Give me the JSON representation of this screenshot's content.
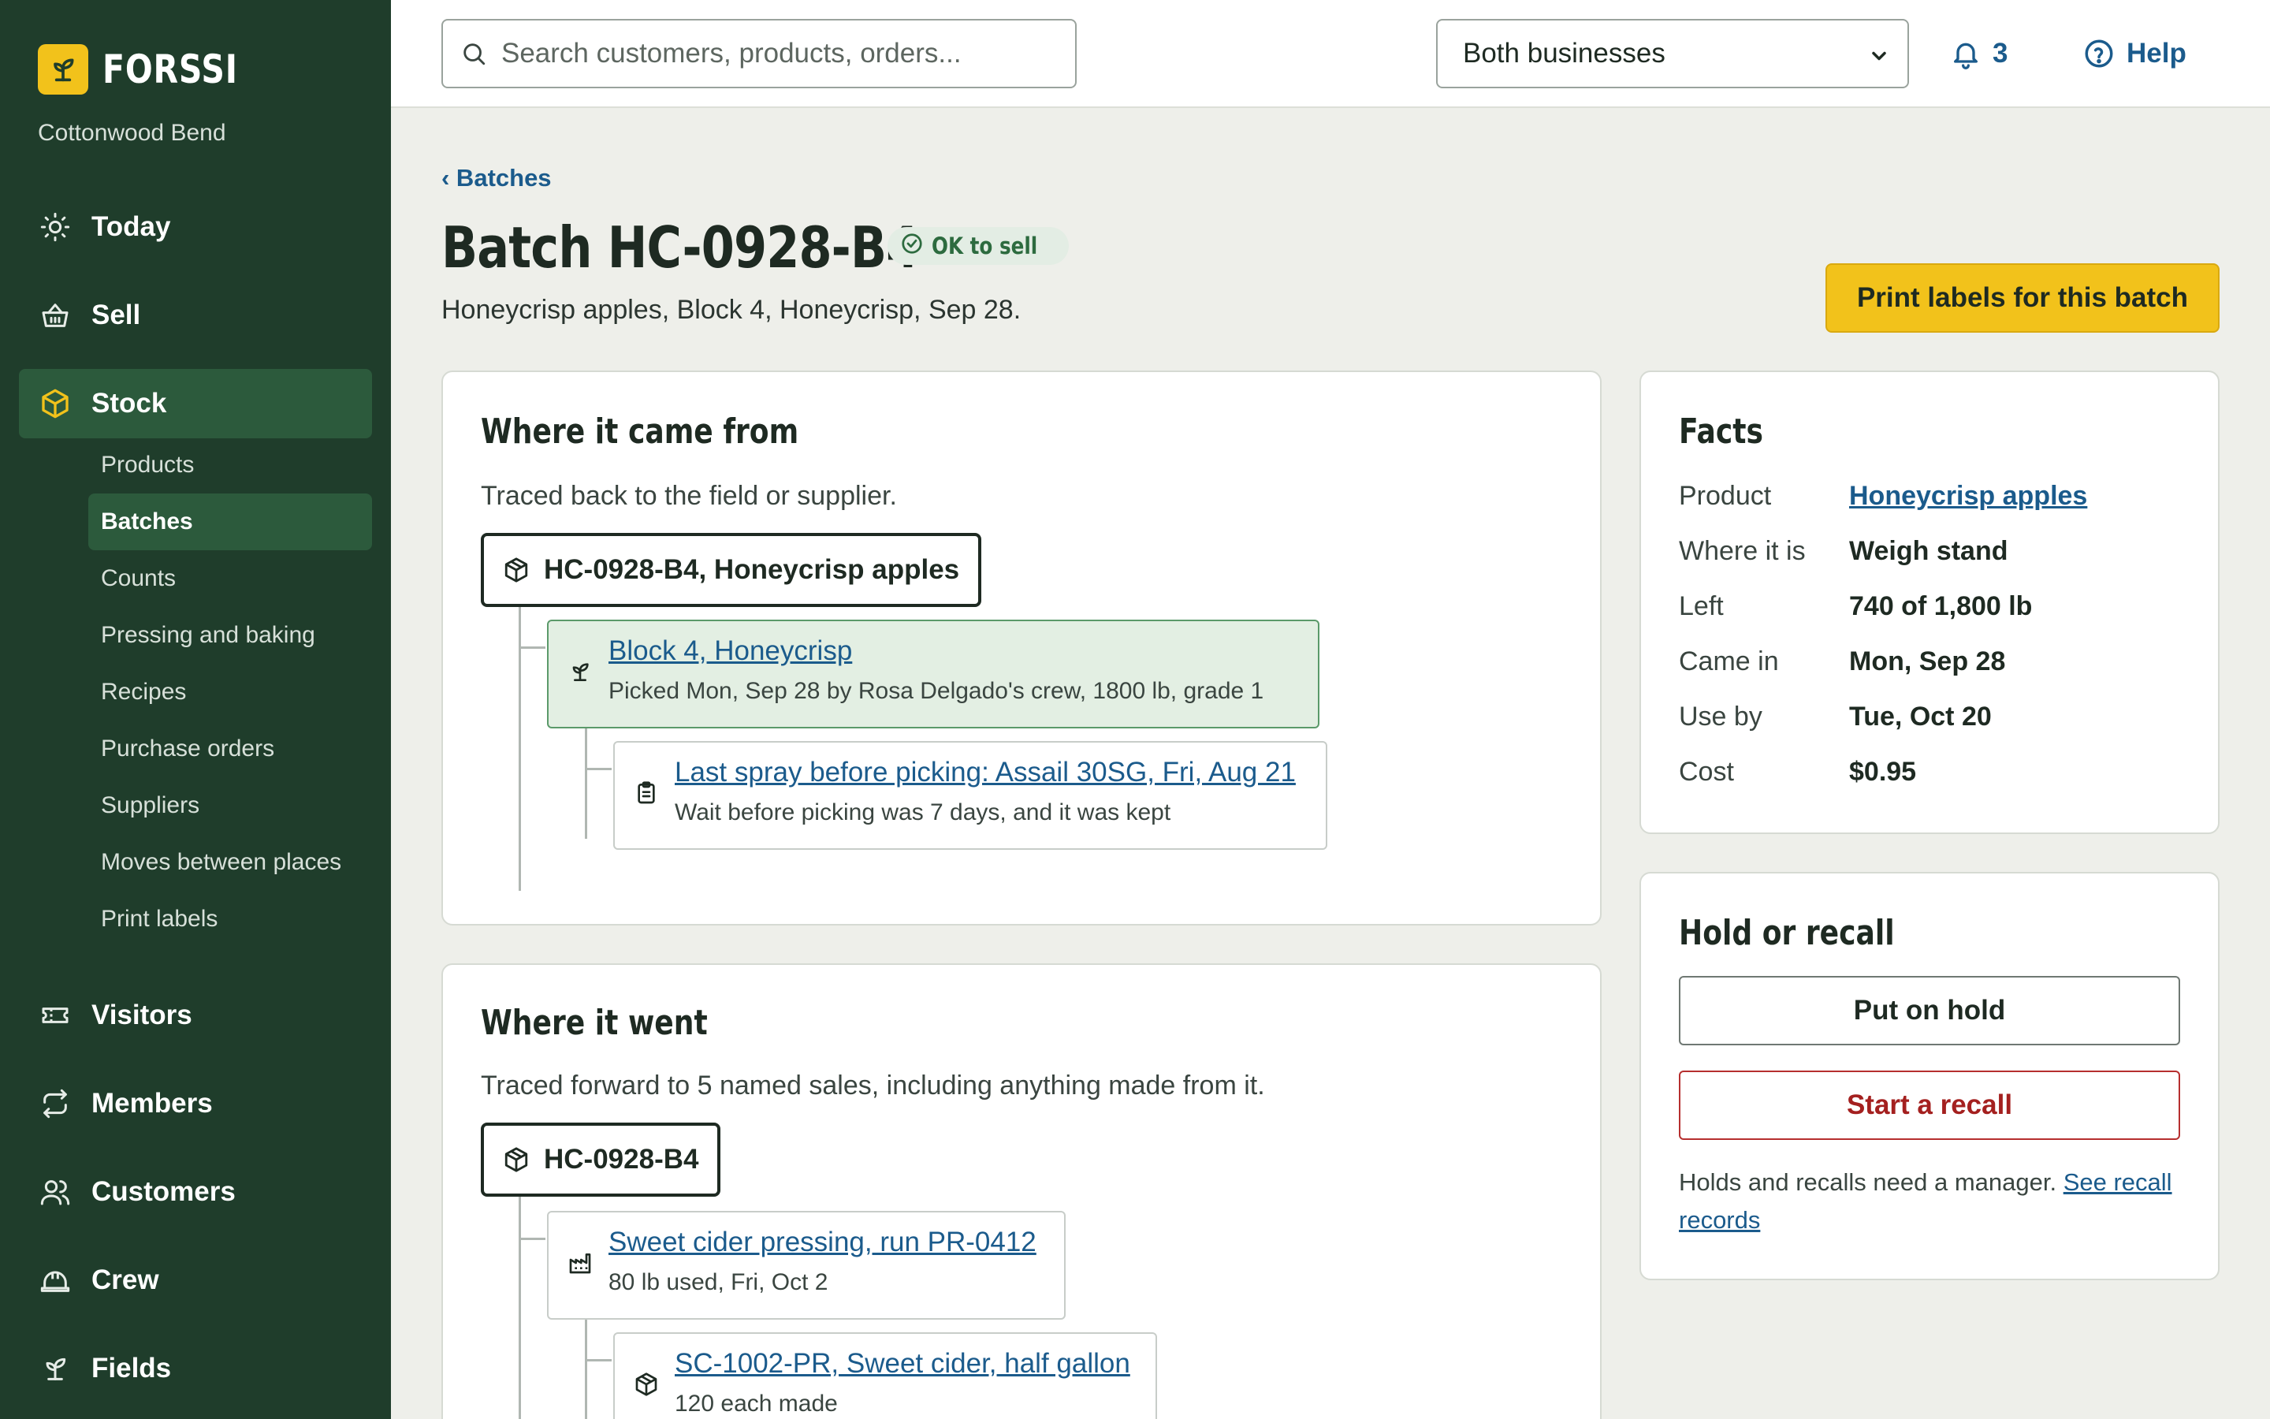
{
  "brand": {
    "name": "FORSSI",
    "org": "Cottonwood Bend",
    "accent": "#f2c21b",
    "sidebar_bg": "#1f3d2b"
  },
  "nav": {
    "today": "Today",
    "sell": "Sell",
    "stock": "Stock",
    "stock_sub": [
      "Products",
      "Batches",
      "Counts",
      "Pressing and baking",
      "Recipes",
      "Purchase orders",
      "Suppliers",
      "Moves between places",
      "Print labels"
    ],
    "visitors": "Visitors",
    "members": "Members",
    "customers": "Customers",
    "crew": "Crew",
    "fields": "Fields"
  },
  "topbar": {
    "search_placeholder": "Search customers, products, orders...",
    "business_selected": "Both businesses",
    "notifications": "3",
    "help": "Help"
  },
  "page": {
    "breadcrumb": "‹ Batches",
    "title": "Batch HC-0928-B4",
    "status": "OK to sell",
    "subtitle": "Honeycrisp apples, Block 4, Honeycrisp, Sep 28.",
    "print_button": "Print labels for this batch"
  },
  "came_from": {
    "title": "Where it came from",
    "desc": "Traced back to the field or supplier.",
    "root": "HC-0928-B4, Honeycrisp apples",
    "nodes": [
      {
        "link": "Block 4, Honeycrisp",
        "meta": "Picked Mon, Sep 28 by Rosa Delgado's crew, 1800 lb, grade 1",
        "icon": "sprout-icon"
      },
      {
        "link": "Last spray before picking: Assail 30SG, Fri, Aug 21",
        "meta": "Wait before picking was 7 days, and it was kept",
        "icon": "clipboard-icon"
      }
    ]
  },
  "went": {
    "title": "Where it went",
    "desc": "Traced forward to 5 named sales, including anything made from it.",
    "root": "HC-0928-B4",
    "nodes": [
      {
        "link": "Sweet cider pressing, run PR-0412",
        "meta": "80 lb used, Fri, Oct 2",
        "icon": "factory-icon"
      },
      {
        "link": "SC-1002-PR, Sweet cider, half gallon",
        "meta": "120 each made",
        "icon": "box-icon"
      }
    ]
  },
  "facts": {
    "title": "Facts",
    "rows": [
      {
        "k": "Product",
        "v": "Honeycrisp apples"
      },
      {
        "k": "Where it is",
        "v": "Weigh stand"
      },
      {
        "k": "Left",
        "v": "740 of 1,800 lb"
      },
      {
        "k": "Came in",
        "v": "Mon, Sep 28"
      },
      {
        "k": "Use by",
        "v": "Tue, Oct 20"
      },
      {
        "k": "Cost",
        "v": "$0.95"
      }
    ]
  },
  "hold": {
    "title": "Hold or recall",
    "hold_button": "Put on hold",
    "recall_button": "Start a recall",
    "note": "Holds and recalls need a manager.",
    "note_link": "See recall records"
  }
}
